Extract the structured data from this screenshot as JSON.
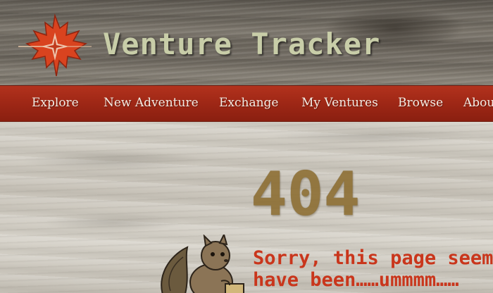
{
  "header": {
    "title": "Venture Tracker",
    "logo_icon": "maple-leaf-compass-icon"
  },
  "nav": {
    "items": [
      {
        "label": "Explore"
      },
      {
        "label": "New Adventure"
      },
      {
        "label": "Exchange"
      },
      {
        "label": "My Ventures"
      },
      {
        "label": "Browse"
      },
      {
        "label": "About"
      }
    ]
  },
  "error": {
    "code": "404",
    "message_line1": "Sorry, this page seems to",
    "message_line2": "have been……ummmm……"
  },
  "mascot": {
    "icon": "squirrel-mascot-icon"
  },
  "colors": {
    "nav_bar": "#a02816",
    "title_text": "#c8cda8",
    "error_code": "#8a6a2c",
    "error_message": "#c9361c",
    "logo_leaf": "#d9431f"
  }
}
